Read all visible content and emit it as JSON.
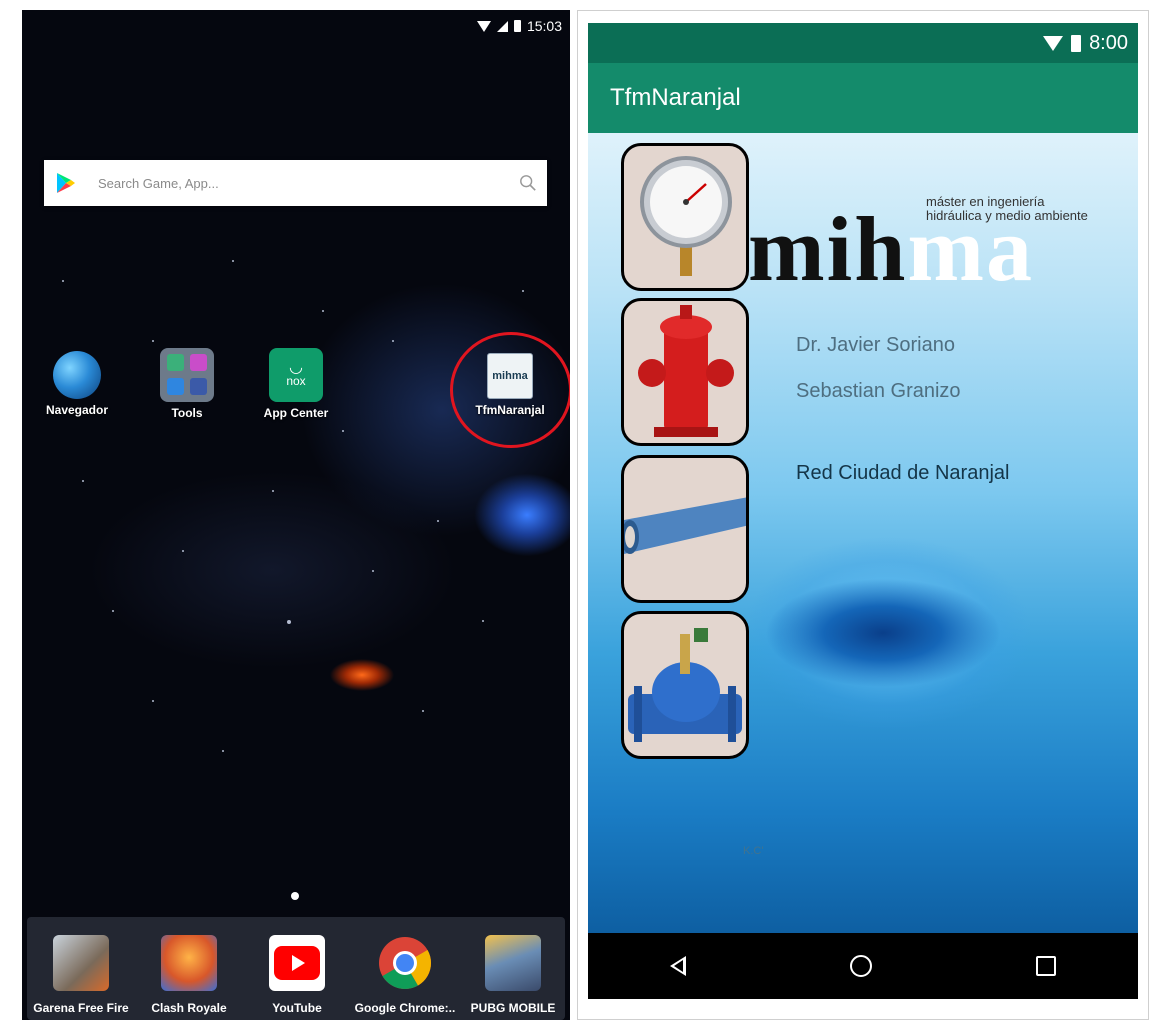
{
  "left_phone": {
    "status_bar": {
      "time": "15:03"
    },
    "search": {
      "placeholder": "Search Game, App..."
    },
    "home_apps": [
      {
        "label": "Navegador",
        "icon": "globe-icon"
      },
      {
        "label": "Tools",
        "icon": "folder-icon"
      },
      {
        "label": "App Center",
        "icon": "app-center-icon",
        "icon_text": "nox"
      },
      {
        "label": "TfmNaranjal",
        "icon": "mihma-app-icon",
        "icon_text": "mihma"
      }
    ],
    "dock_apps": [
      {
        "label": "Garena Free Fire",
        "icon": "free-fire-icon"
      },
      {
        "label": "Clash Royale",
        "icon": "clash-royale-icon"
      },
      {
        "label": "YouTube",
        "icon": "youtube-icon"
      },
      {
        "label": "Google Chrome:..",
        "icon": "chrome-icon"
      },
      {
        "label": "PUBG MOBILE",
        "icon": "pubg-icon"
      }
    ],
    "highlight_color": "#e1151f"
  },
  "right_phone": {
    "status_bar": {
      "time": "8:00"
    },
    "app_bar": {
      "title": "TfmNaranjal"
    },
    "logo": {
      "line1": "máster en ingeniería",
      "line2": "hidráulica y medio ambiente",
      "word_dark": "mih",
      "word_light": "ma"
    },
    "credits": [
      "Dr. Javier Soriano",
      "Sebastian Granizo"
    ],
    "project_name": "Red Ciudad de Naranjal",
    "signature": "K.C'",
    "menu_images": [
      "pressure-gauge-icon",
      "fire-hydrant-icon",
      "pipe-icon",
      "valve-icon"
    ],
    "colors": {
      "status_bar": "#0b6e55",
      "app_bar": "#148b6b"
    }
  }
}
